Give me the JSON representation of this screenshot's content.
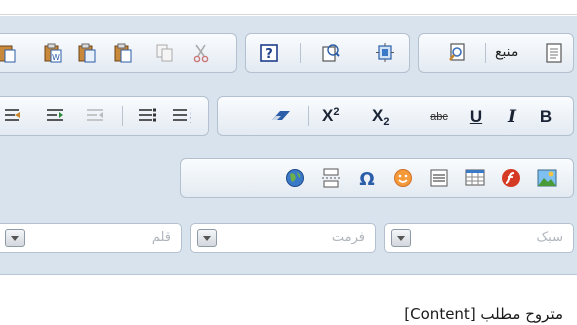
{
  "toolbar": {
    "row1": {
      "source_label": "منبع"
    },
    "format": {
      "bold": "B",
      "italic": "I",
      "underline": "U",
      "strike": "abc",
      "subscript": "X",
      "subscript_mark": "2",
      "superscript": "X",
      "superscript_mark": "2"
    },
    "combos": {
      "style_label": "سبک",
      "format_label": "فرمت",
      "font_label": "قلم"
    }
  },
  "editor": {
    "content": "متروح مطلب [Content]"
  },
  "colors": {
    "toolbar_bg": "#d9e3ee",
    "group_border": "#b3c0cf",
    "icon_blue": "#2b5da8"
  }
}
